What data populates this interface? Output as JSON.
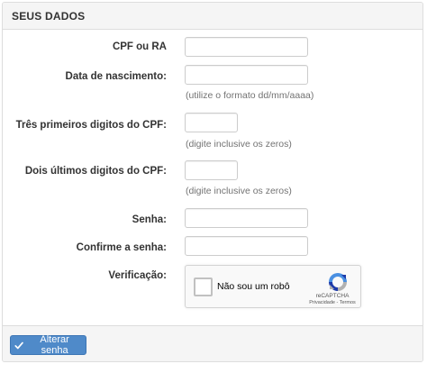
{
  "panel": {
    "title": "SEUS DADOS"
  },
  "form": {
    "cpf_ra_label": "CPF ou RA",
    "birth_label": "Data de nascimento:",
    "birth_help": "(utilize o formato dd/mm/aaaa)",
    "first_digits_label": "Três primeiros digitos do CPF:",
    "first_digits_help": "(digite inclusive os zeros)",
    "last_digits_label": "Dois últimos digitos do CPF:",
    "last_digits_help": "(digite inclusive os zeros)",
    "password_label": "Senha:",
    "confirm_label": "Confirme a senha:",
    "verification_label": "Verificação:"
  },
  "captcha": {
    "text": "Não sou um robô",
    "brand": "reCAPTCHA",
    "links": "Privacidade - Termos",
    "colors": {
      "blue": "#1c3aa9",
      "light_blue": "#4a90e2",
      "gray": "#b1b1b1"
    }
  },
  "footer": {
    "submit_label": "Alterar senha",
    "submit_icon": "check-icon",
    "accent": "#4f8ac9"
  }
}
